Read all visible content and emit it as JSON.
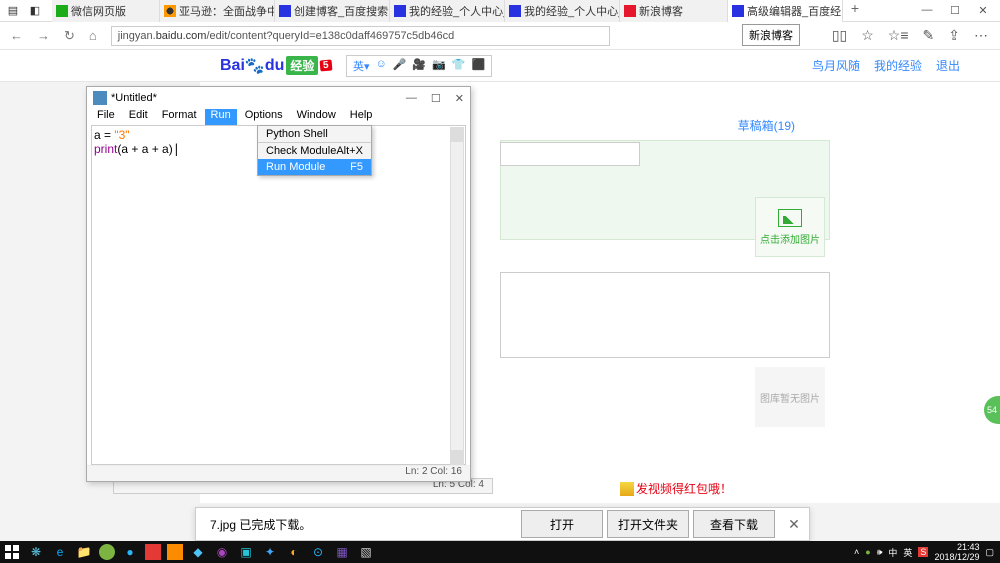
{
  "titlebar": {
    "tabs": [
      {
        "label": "微信网页版"
      },
      {
        "label": "亚马逊：全面战争中文补"
      },
      {
        "label": "创建博客_百度搜索"
      },
      {
        "label": "我的经验_个人中心_百度"
      },
      {
        "label": "我的经验_个人中心_百度"
      },
      {
        "label": "新浪博客"
      },
      {
        "label": "高级编辑器_百度经"
      }
    ],
    "tooltip": "新浪博客",
    "win": {
      "min": "—",
      "max": "☐",
      "close": "✕"
    }
  },
  "nav": {
    "url_prefix": "jingyan.",
    "url_host": "baidu.com",
    "url_path": "/edit/content?queryId=e138c0daff469757c5db46cd"
  },
  "header": {
    "logo_baidu": "Bai",
    "logo_du": "du",
    "logo_jingyan": "经验",
    "logo_badge": "5",
    "links": [
      "鸟月风随",
      "我的经验",
      "退出"
    ]
  },
  "page": {
    "draft": "草稿箱(19)",
    "add_image": "点击添加图片",
    "no_image": "图库暂无图片",
    "promo": "发视频得红包哦！"
  },
  "green_badge": "54",
  "idle": {
    "title": "*Untitled*",
    "menus": [
      "File",
      "Edit",
      "Format",
      "Run",
      "Options",
      "Window",
      "Help"
    ],
    "dropdown": {
      "shell": "Python Shell",
      "check": "Check Module",
      "check_key": "Alt+X",
      "run": "Run Module",
      "run_key": "F5"
    },
    "code_a": "a = ",
    "code_str": "\"3\"",
    "code_print": "print",
    "code_rest": "(a + a + a)",
    "status1": "Ln: 2  Col: 16",
    "status2": "Ln: 5  Col: 4"
  },
  "download": {
    "text": "7.jpg 已完成下载。",
    "open": "打开",
    "open_folder": "打开文件夹",
    "view": "查看下载"
  },
  "taskbar": {
    "time": "21:43",
    "date": "2018/12/29"
  }
}
